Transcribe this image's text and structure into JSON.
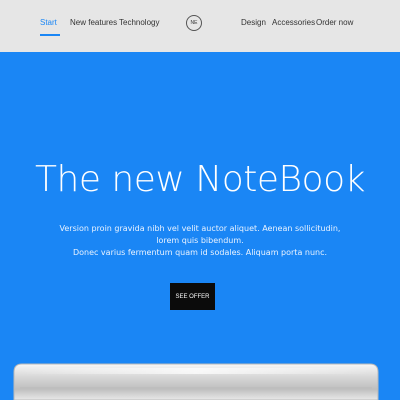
{
  "nav": {
    "items": [
      "Start",
      "New features",
      "Technology",
      "Design",
      "Accessories",
      "Order now"
    ],
    "logo_text": "NE"
  },
  "hero": {
    "title": "The new NoteBook",
    "subtitle_lines": [
      "Version proin gravida nibh vel velit auctor aliquet. Aenean sollicitudin, lorem quis bibendum.",
      "Donec varius fermentum quam id sodales. Aliquam porta nunc."
    ],
    "cta_label": "SEE OFFER",
    "colors": {
      "background": "#1a86f5",
      "nav_background": "#e6e6e6",
      "accent": "#1a86f5",
      "cta_background": "#0b0b0b"
    },
    "image": "laptop-image"
  }
}
